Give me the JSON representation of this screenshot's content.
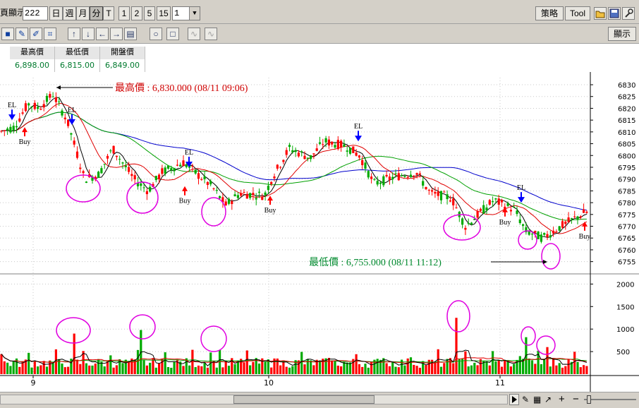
{
  "toolbar": {
    "display_label": "頁顯示",
    "count_value": "222",
    "period_buttons": [
      "日",
      "週",
      "月",
      "分",
      "T"
    ],
    "interval_buttons": [
      "1",
      "2",
      "5",
      "15"
    ],
    "interval_value": "1",
    "strategy_label": "策略",
    "tool_label": "Tool",
    "display_button": "顯示"
  },
  "info": {
    "headers": [
      "最高價",
      "最低價",
      "開盤價"
    ],
    "values": [
      "6,898.00",
      "6,815.00",
      "6,849.00"
    ]
  },
  "annotations": {
    "high_label": "最高價 : 6,830.000 (08/11 09:06)",
    "low_label": "最低價 : 6,755.000 (08/11 11:12)",
    "buy": "Buy",
    "el": "EL"
  },
  "chart_data": {
    "type": "candlestick",
    "price_axis_ticks": [
      6830,
      6825,
      6820,
      6815,
      6810,
      6805,
      6800,
      6795,
      6790,
      6785,
      6780,
      6775,
      6770,
      6765,
      6760,
      6755
    ],
    "price_range": [
      6751,
      6833
    ],
    "volume_axis_ticks": [
      2000,
      1500,
      1000,
      500
    ],
    "volume_range": [
      0,
      2100
    ],
    "date_labels": [
      "9",
      "10",
      "11"
    ],
    "buy_signals": 5,
    "el_signals": 5,
    "colors": {
      "up": "#ff0000",
      "down": "#00aa00",
      "ma_short": "#000000",
      "ma_mid": "#e00000",
      "ma_long": "#00a000",
      "ma_longest": "#0000cc",
      "highlight": "#e000e0"
    }
  }
}
